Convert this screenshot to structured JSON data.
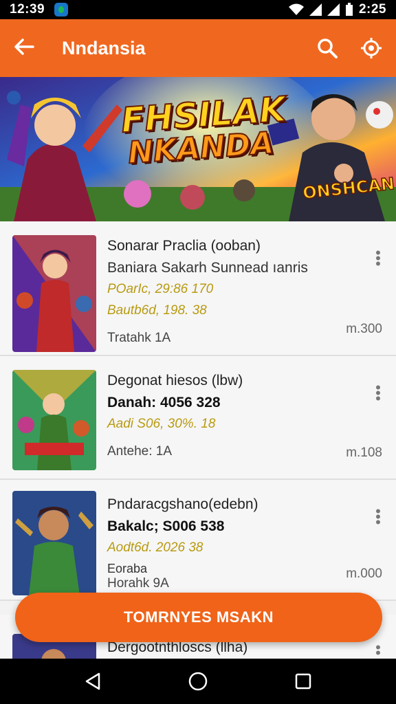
{
  "status_bar": {
    "time": "12:39",
    "right_time": "2:25"
  },
  "app_bar": {
    "title": "Nndansia",
    "back_icon": "arrow-left-icon",
    "search_icon": "search-icon",
    "target_icon": "location-target-icon"
  },
  "banner": {
    "title_line1": "FHSILAK",
    "title_line2": "NKANDA",
    "badge": "ONSHCAN"
  },
  "items": [
    {
      "line1": "Sonarar Praclia (ooban)",
      "line2": "Baniara Sakarh Sunnead ıanris",
      "line3": "POarIc, 29:86 170",
      "line4": "Bautb6d, 198. 38",
      "line5": "Tratahk 1A",
      "price": "m.300"
    },
    {
      "line1": "Degonat hiesos (lbw)",
      "line2": "Danah: 4056 328",
      "line3": "Aadi S06, 30%. 18",
      "line4": "",
      "line5": "Antehe: 1A",
      "price": "m.108"
    },
    {
      "line1": "Pndaracgshano(edebn)",
      "line2": "Bakalc; S006 538",
      "line3": "Aodt6d. 2026 38",
      "line4": "Eoraba",
      "line5": "Horahk 9A",
      "price": "m.000"
    }
  ],
  "partial_item": {
    "line1": "Dergootnthloscs (llha)"
  },
  "cta": {
    "label": "TOMRNYES MSAKN"
  },
  "colors": {
    "primary": "#f06820",
    "accent_text": "#b89a12"
  }
}
